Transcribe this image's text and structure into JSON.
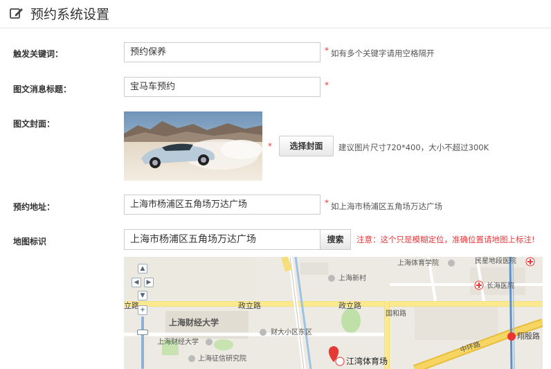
{
  "header": {
    "title": "预约系统设置",
    "icon": "edit-icon"
  },
  "form": {
    "keyword": {
      "label": "触发关键词：",
      "value": "预约保养",
      "required": "*",
      "hint": "如有多个关键字请用空格隔开"
    },
    "news_title": {
      "label": "图文消息标题：",
      "value": "宝马车预约",
      "required": "*"
    },
    "cover": {
      "label": "图文封面：",
      "required": "*",
      "button": "选择封面",
      "hint": "建议图片尺寸720*400，大小不超过300K"
    },
    "address": {
      "label": "预约地址：",
      "value": "上海市杨浦区五角场万达广场",
      "required": "*",
      "hint": "如上海市杨浦区五角场万达广场"
    },
    "map_marker": {
      "label": "地图标识",
      "search_value": "上海市杨浦区五角场万达广场",
      "search_button": "搜索",
      "warning": "注意：这个只是模糊定位，准确位置请地图上标注!"
    }
  },
  "map": {
    "labels": {
      "sports_school": "上海体育学院",
      "minxing_hospital": "民星地段医院",
      "new_village": "上海新村",
      "changhai_hospital": "长海医院",
      "zhengli_road_left": "政立路",
      "zhengli_road_mid": "政立路",
      "zhengli_road_right": "政立路",
      "sufe_big": "上海财经大学",
      "sufe_small": "上海财经大学",
      "caida_district": "财大小区东区",
      "guohe_road": "国和路",
      "zhonghuan_road": "中环路",
      "xiangyin_road": "翔殷路",
      "credit_institute": "上海征信研究院",
      "jiangwan_stadium": "江湾体育场",
      "road_left": "立路"
    }
  }
}
